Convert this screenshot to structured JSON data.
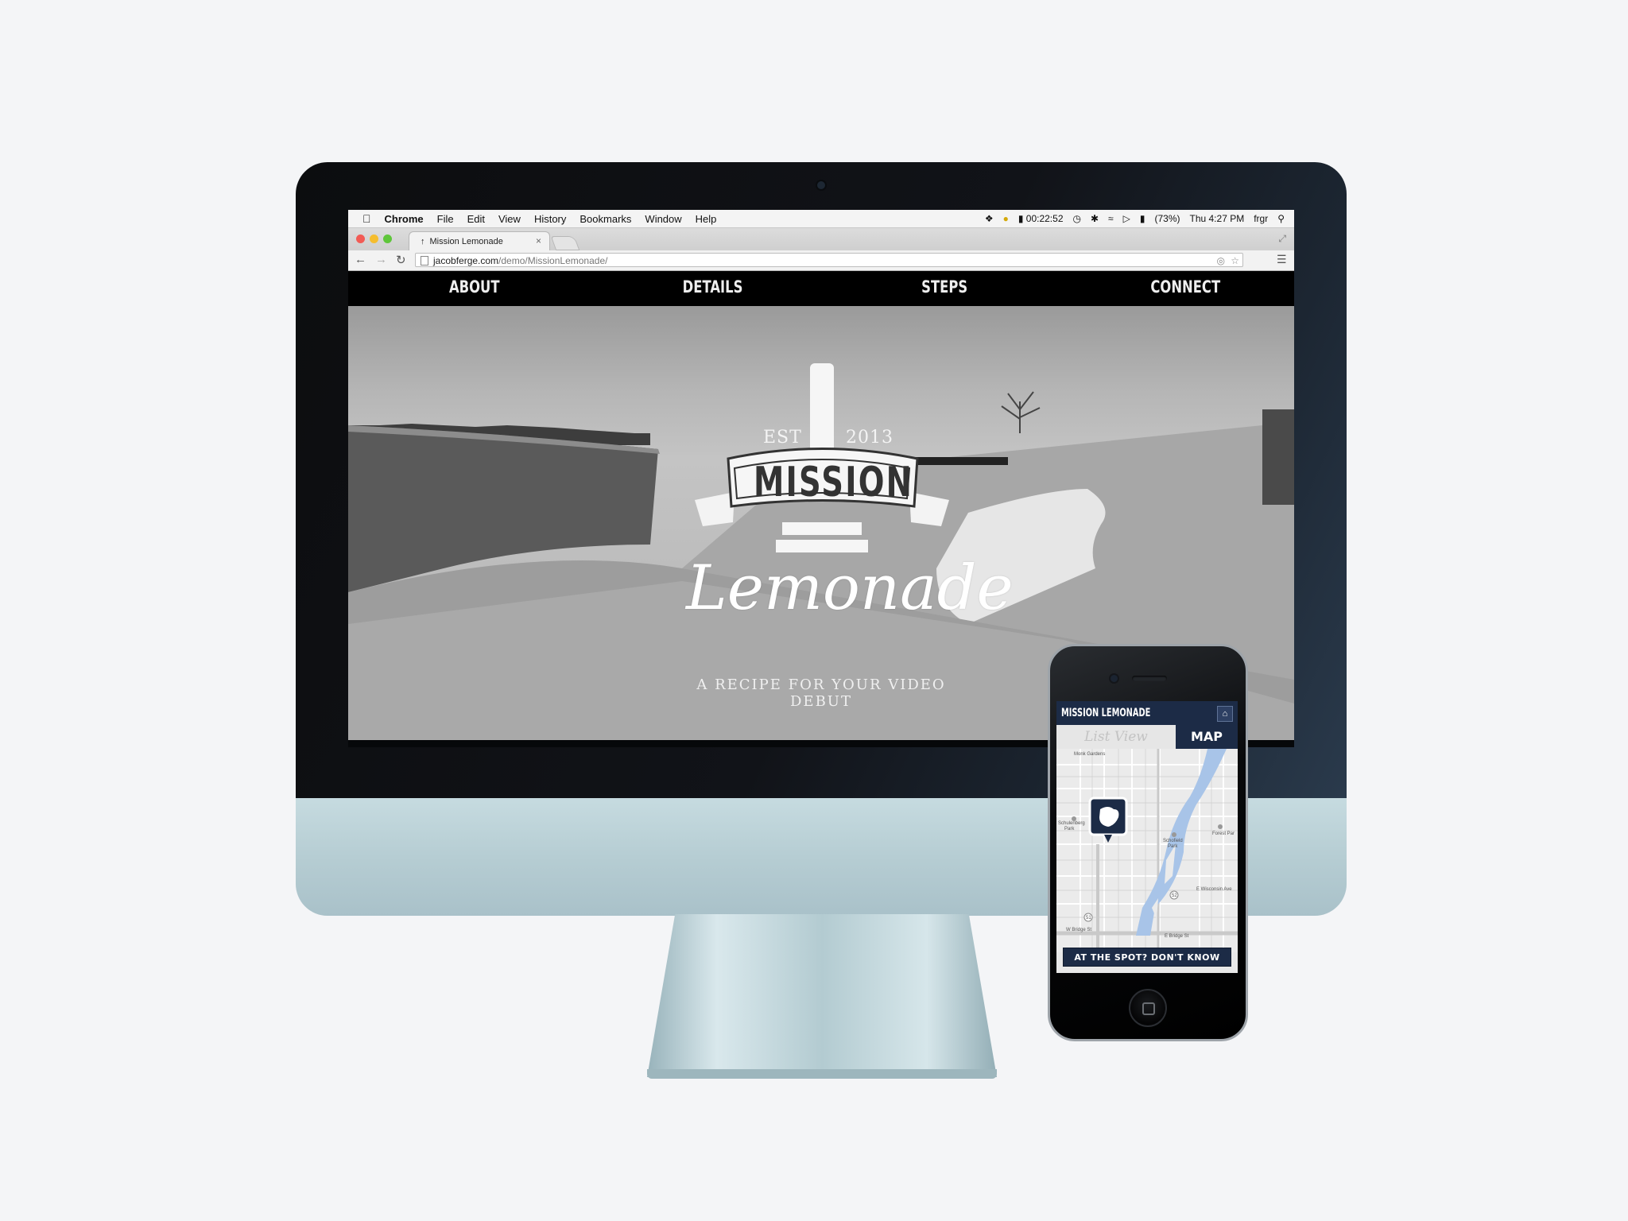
{
  "mac_menubar": {
    "app": "Chrome",
    "items": [
      "File",
      "Edit",
      "View",
      "History",
      "Bookmarks",
      "Window",
      "Help"
    ],
    "timer": "00:22:52",
    "battery": "(73%)",
    "clock": "Thu 4:27 PM",
    "user": "frgr"
  },
  "browser": {
    "tab_title": "Mission Lemonade",
    "url_domain": "jacobferge.com",
    "url_path": "/demo/MissionLemonade/"
  },
  "site": {
    "nav": [
      "ABOUT",
      "DETAILS",
      "STEPS",
      "CONNECT"
    ],
    "hero": {
      "est": "EST",
      "year": "2013",
      "brand_top": "MISSION",
      "brand_script": "Lemonade",
      "tagline": "A RECIPE FOR YOUR VIDEO DEBUT"
    }
  },
  "phone_app": {
    "title": "MISSION LEMONADE",
    "tab_list": "List View",
    "tab_map": "MAP",
    "cta": "AT THE SPOT? DON'T KNOW WHAT'S NEXT?",
    "map_labels": {
      "top": "Monk Gardens",
      "park1": "Schulenberg",
      "park1b": "Park",
      "park2": "Schofield",
      "park2b": "Park",
      "park3": "Forest Par",
      "street1": "E Wisconsin Ave",
      "street2": "W Bridge St",
      "street3": "E Bridge St",
      "route1": "51",
      "route2": "52"
    }
  },
  "colors": {
    "navy": "#1c2b46",
    "river": "#a8c4e8"
  }
}
